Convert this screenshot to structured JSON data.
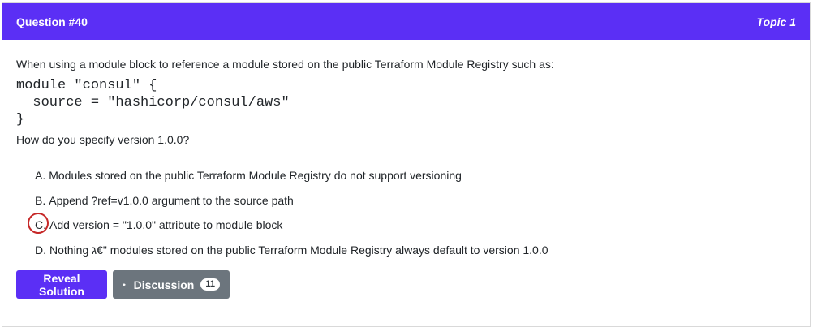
{
  "header": {
    "question_label": "Question #40",
    "topic_label": "Topic 1",
    "accent_color": "#5b2ff5"
  },
  "question": {
    "intro": "When using a module block to reference a module stored on the public Terraform Module Registry such as:",
    "code_lines": [
      "module \"consul\" {",
      "  source = \"hashicorp/consul/aws\"",
      "}"
    ],
    "ask": "How do you specify version 1.0.0?"
  },
  "choices": [
    {
      "letter": "A.",
      "text": "Modules stored on the public Terraform Module Registry do not support versioning"
    },
    {
      "letter": "B.",
      "text": "Append ?ref=v1.0.0 argument to the source path"
    },
    {
      "letter": "C.",
      "text": "Add version = \"1.0.0\" attribute to module block",
      "marked": true
    },
    {
      "letter": "D.",
      "text": "Nothing ג€\" modules stored on the public Terraform Module Registry always default to version 1.0.0"
    }
  ],
  "actions": {
    "reveal_label": "Reveal Solution",
    "discussion_label": "Discussion",
    "discussion_count": "11",
    "discussion_icon": "comment-bubble-icon"
  }
}
